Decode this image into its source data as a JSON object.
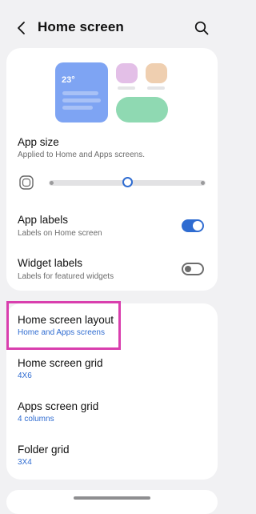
{
  "header": {
    "title": "Home screen"
  },
  "preview": {
    "temperature": "23°"
  },
  "settings": {
    "app_size": {
      "title": "App size",
      "subtitle": "Applied to Home and Apps screens.",
      "slider_value": 0.5
    },
    "app_labels": {
      "title": "App labels",
      "subtitle": "Labels on Home screen",
      "enabled": true
    },
    "widget_labels": {
      "title": "Widget labels",
      "subtitle": "Labels for featured widgets",
      "enabled": false
    }
  },
  "layout": {
    "home_screen_layout": {
      "title": "Home screen layout",
      "value": "Home and Apps screens"
    },
    "home_screen_grid": {
      "title": "Home screen grid",
      "value": "4X6"
    },
    "apps_screen_grid": {
      "title": "Apps screen grid",
      "value": "4 columns"
    },
    "folder_grid": {
      "title": "Folder grid",
      "value": "3X4"
    }
  },
  "colors": {
    "accent": "#2f6cd1",
    "highlight": "#d93fae",
    "background": "#f1f1f3"
  },
  "icons": {
    "back": "chevron-left-icon",
    "search": "search-icon",
    "app_size": "app-size-icon"
  }
}
